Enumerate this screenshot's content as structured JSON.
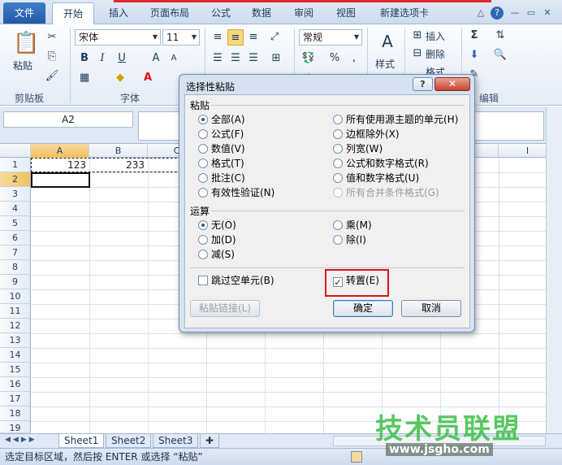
{
  "tabs": [
    "文件",
    "开始",
    "插入",
    "页面布局",
    "公式",
    "数据",
    "审阅",
    "视图",
    "新建选项卡"
  ],
  "window_buttons": [
    "△",
    "?",
    "—",
    "▭",
    "✕"
  ],
  "ribbon": {
    "paste_label": "粘贴",
    "clipboard_label": "剪贴板",
    "font_label": "字体",
    "font_name": "宋体",
    "font_size": "11",
    "number_format": "常规",
    "style_label": "样式",
    "insert_label": "插入",
    "delete_label": "删除",
    "format_label": "格式",
    "edit_label": "编辑",
    "bold": "B",
    "italic": "I",
    "underline": "U"
  },
  "namebox": "A2",
  "columns": [
    "A",
    "B",
    "C",
    "D",
    "E",
    "F",
    "G",
    "H",
    "I"
  ],
  "rows": [
    "1",
    "2",
    "3",
    "4",
    "5",
    "6",
    "7",
    "8",
    "9",
    "10",
    "11",
    "12",
    "13",
    "14",
    "15",
    "16",
    "17",
    "18",
    "19"
  ],
  "cells": {
    "A1": "123",
    "B1": "233"
  },
  "sheets": [
    "Sheet1",
    "Sheet2",
    "Sheet3"
  ],
  "status_text": "选定目标区域，然后按 ENTER 或选择 “粘贴”",
  "dialog": {
    "title": "选择性粘贴",
    "help": "?",
    "close": "✕",
    "paste_section": "粘贴",
    "paste_left": [
      "全部(A)",
      "公式(F)",
      "数值(V)",
      "格式(T)",
      "批注(C)",
      "有效性验证(N)"
    ],
    "paste_right": [
      "所有使用源主题的单元(H)",
      "边框除外(X)",
      "列宽(W)",
      "公式和数字格式(R)",
      "值和数字格式(U)",
      "所有合并条件格式(G)"
    ],
    "operation_section": "运算",
    "op_left": [
      "无(O)",
      "加(D)",
      "减(S)"
    ],
    "op_right": [
      "乘(M)",
      "除(I)"
    ],
    "skip_blanks": "跳过空单元(B)",
    "transpose": "转置(E)",
    "paste_link": "粘贴链接(L)",
    "ok": "确定",
    "cancel": "取消"
  },
  "watermark": {
    "brand": "技术员联盟",
    "url": "www.jsgho.com"
  }
}
